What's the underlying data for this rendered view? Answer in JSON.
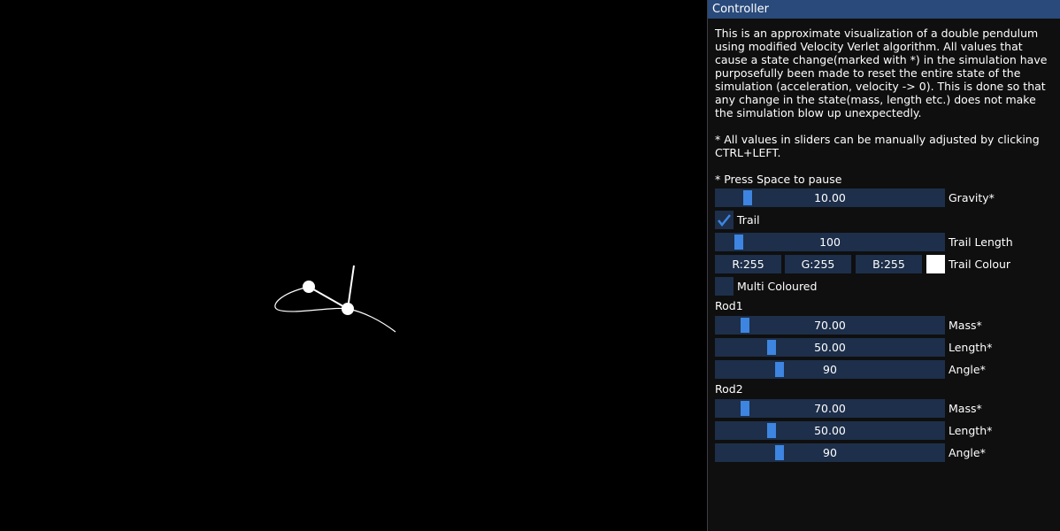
{
  "panel": {
    "title": "Controller",
    "description": "This is an approximate visualization of a double pendulum using modified Velocity Verlet algorithm. All values that cause a state change(marked with *) in the simulation have purposefully been made to reset the entire state of the simulation (acceleration, velocity -> 0). This is done so that any change in the state(mass, length etc.) does not make the simulation blow up unexpectedly.",
    "note_sliders": "* All values in sliders can be manually adjusted by clicking CTRL+LEFT.",
    "note_pause": "* Press Space to pause"
  },
  "gravity": {
    "label": "Gravity*",
    "value": "10.00",
    "fraction": 0.12
  },
  "trail": {
    "label": "Trail",
    "checked": true
  },
  "trail_length": {
    "label": "Trail Length",
    "value": "100",
    "fraction": 0.08
  },
  "trail_colour": {
    "label": "Trail Colour",
    "r": "R:255",
    "g": "G:255",
    "b": "B:255",
    "color": "#ffffff"
  },
  "multi_coloured": {
    "label": "Multi Coloured",
    "checked": false
  },
  "rod1": {
    "title": "Rod1",
    "mass": {
      "label": "Mass*",
      "value": "70.00",
      "fraction": 0.11
    },
    "length": {
      "label": "Length*",
      "value": "50.00",
      "fraction": 0.23
    },
    "angle": {
      "label": "Angle*",
      "value": "90",
      "fraction": 0.27
    }
  },
  "rod2": {
    "title": "Rod2",
    "mass": {
      "label": "Mass*",
      "value": "70.00",
      "fraction": 0.11
    },
    "length": {
      "label": "Length*",
      "value": "50.00",
      "fraction": 0.23
    },
    "angle": {
      "label": "Angle*",
      "value": "90",
      "fraction": 0.27
    }
  },
  "colors": {
    "title_bar": "#294a7a",
    "frame": "#1d2f4a",
    "grab": "#3d85e0",
    "pendulum": "#ffffff"
  }
}
